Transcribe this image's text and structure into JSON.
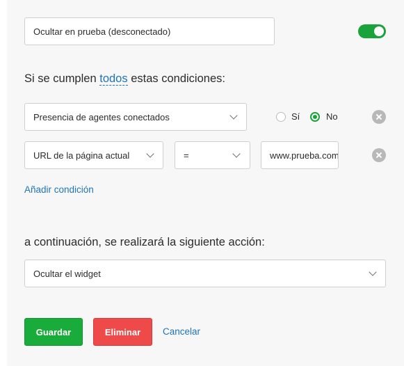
{
  "rule": {
    "name_value": "Ocultar en prueba (desconectado)",
    "enabled": true,
    "accent_color": "#1aa33a"
  },
  "conditions": {
    "heading_prefix": "Si se cumplen",
    "heading_mode": "todos",
    "heading_suffix": "estas condiciones:",
    "rows": [
      {
        "field": "Presencia de agentes conectados",
        "options": [
          {
            "label": "Sí",
            "selected": false
          },
          {
            "label": "No",
            "selected": true
          }
        ]
      },
      {
        "field": "URL de la página actual",
        "operator": "=",
        "value": "www.prueba.com"
      }
    ],
    "add_label": "Añadir condición"
  },
  "action": {
    "heading": "a continuación, se realizará la siguiente acción:",
    "selected": "Ocultar el widget"
  },
  "buttons": {
    "save_label": "Guardar",
    "delete_label": "Eliminar",
    "cancel_label": "Cancelar",
    "save_color": "#19ac3b",
    "delete_color": "#ef4a4a",
    "link_color": "#1f73b7"
  }
}
